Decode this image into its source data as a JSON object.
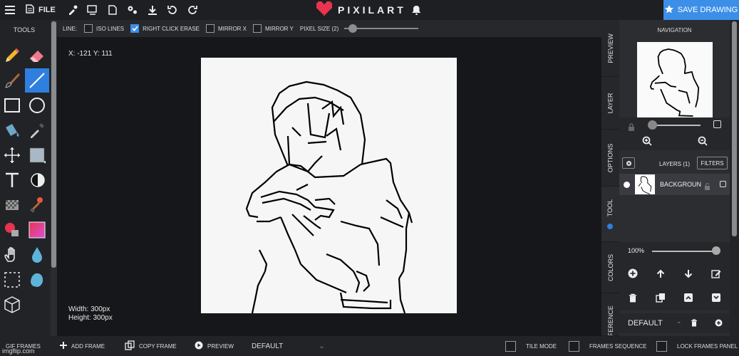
{
  "topbar": {
    "file_label": "FILE",
    "brand": "PIXILART",
    "save_label": "SAVE DRAWING",
    "accent": "#3c8fe9",
    "icons": [
      "menu-icon",
      "file-icon",
      "eyedropper-icon",
      "resize-icon",
      "page-icon",
      "settings-icon",
      "download-icon",
      "undo-icon",
      "redo-icon",
      "bell-icon",
      "star-icon"
    ]
  },
  "tools": {
    "title": "TOOLS",
    "items": [
      "pencil-tool",
      "eraser-tool",
      "brush-tool",
      "line-tool",
      "rectangle-tool",
      "ellipse-tool",
      "fill-bucket-tool",
      "color-picker-tool",
      "move-tool",
      "selection-tool",
      "text-tool",
      "light-dark-tool",
      "dither-tool",
      "stamp-tool",
      "shape-brush-tool",
      "gradient-tool",
      "hand-tool",
      "blur-tool",
      "marquee-tool",
      "smudge-tool",
      "3d-cube-tool"
    ],
    "active": "line-tool"
  },
  "options": {
    "line_label": "LINE:",
    "iso_lines": "ISO LINES",
    "right_click_erase": "RIGHT CLICK ERASE",
    "mirror_x": "MIRROR X",
    "mirror_y": "MIRROR Y",
    "pixel_size": "PIXEL SIZE (2)",
    "pixel_size_value": 2,
    "iso_lines_checked": false,
    "right_click_erase_checked": true,
    "mirror_x_checked": false,
    "mirror_y_checked": false
  },
  "workspace": {
    "coords": "X: -121 Y: 111",
    "width_text": "Width: 300px",
    "height_text": "Height: 300px"
  },
  "side_tabs": {
    "preview": "PREVIEW",
    "layer": "LAYER",
    "options": "OPTIONS",
    "tool": "TOOL",
    "colors": "COLORS",
    "reference": "REFERENCE"
  },
  "panel": {
    "navigation_title": "NAVIGATION",
    "layers_title": "LAYERS (1)",
    "filters_label": "FILTERS",
    "layer_name": "BACKGROUND",
    "opacity": "100%",
    "opacity_value": 100,
    "animation": "DEFAULT"
  },
  "bottombar": {
    "gif_frames": "GIF FRAMES",
    "add_frame": "ADD FRAME",
    "copy_frame": "COPY FRAME",
    "preview": "PREVIEW",
    "animation_select": "DEFAULT",
    "tile_mode": "TILE MODE",
    "frames_sequence": "FRAMES SEQUENCE",
    "lock_frames_panel": "LOCK FRAMES PANEL",
    "watermark": "imgflip.com"
  }
}
